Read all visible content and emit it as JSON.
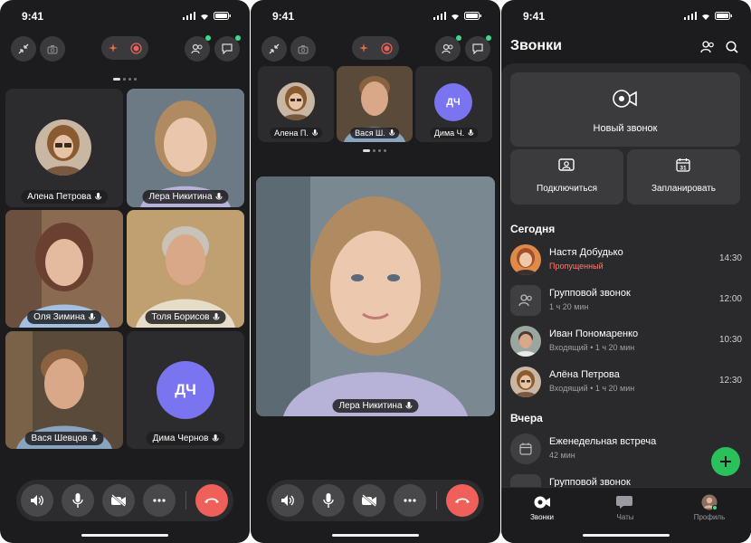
{
  "status": {
    "time": "9:41"
  },
  "call": {
    "grid_tiles": [
      {
        "name": "Алена Петрова"
      },
      {
        "name": "Лера Никитина"
      },
      {
        "name": "Оля Зимина"
      },
      {
        "name": "Толя Борисов"
      },
      {
        "name": "Вася Шевцов"
      },
      {
        "name": "Дима Чернов",
        "initials": "ДЧ"
      }
    ],
    "strip_tiles": [
      {
        "name": "Алена П."
      },
      {
        "name": "Вася Ш."
      },
      {
        "name": "Дима Ч.",
        "initials": "ДЧ"
      }
    ],
    "speaker": {
      "name": "Лера Никитина"
    }
  },
  "calls_screen": {
    "title": "Звонки",
    "new_call": "Новый звонок",
    "join": "Подключиться",
    "schedule": "Запланировать",
    "schedule_day": "31",
    "today": "Сегодня",
    "yesterday": "Вчера",
    "items": [
      {
        "name": "Настя Добудько",
        "sub": "Пропущенный",
        "time": "14:30"
      },
      {
        "name": "Групповой звонок",
        "sub": "1 ч 20 мин",
        "time": "12:00"
      },
      {
        "name": "Иван Пономаренко",
        "sub": "Входящий • 1 ч 20 мин",
        "time": "10:30"
      },
      {
        "name": "Алёна Петрова",
        "sub": "Входящий • 1 ч 20 мин",
        "time": "12:30"
      }
    ],
    "yesterday_items": [
      {
        "name": "Еженедельная встреча",
        "sub": "42 мин"
      },
      {
        "name": "Групповой звонок"
      }
    ],
    "tabs": {
      "calls": "Звонки",
      "chats": "Чаты",
      "profile": "Профиль"
    }
  },
  "colors": {
    "accent_end": "#f0605a",
    "avatar_initials": "#7a74f0",
    "fab": "#2bc15a",
    "missed": "#ff7a70"
  }
}
